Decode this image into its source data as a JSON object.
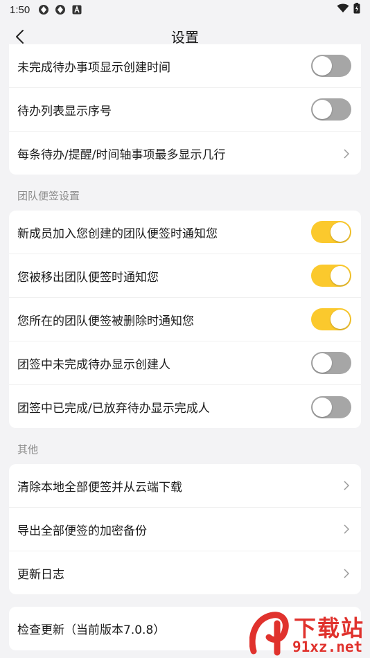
{
  "status_bar": {
    "time": "1:50"
  },
  "header": {
    "title": "设置"
  },
  "card_top": {
    "rows": [
      {
        "label": "未完成待办事项显示创建时间",
        "control": "toggle",
        "on": false
      },
      {
        "label": "待办列表显示序号",
        "control": "toggle",
        "on": false
      },
      {
        "label": "每条待办/提醒/时间轴事项最多显示几行",
        "control": "chevron"
      }
    ]
  },
  "team_section": {
    "title": "团队便签设置",
    "rows": [
      {
        "label": "新成员加入您创建的团队便签时通知您",
        "control": "toggle",
        "on": true
      },
      {
        "label": "您被移出团队便签时通知您",
        "control": "toggle",
        "on": true
      },
      {
        "label": "您所在的团队便签被删除时通知您",
        "control": "toggle",
        "on": true
      },
      {
        "label": "团签中未完成待办显示创建人",
        "control": "toggle",
        "on": false
      },
      {
        "label": "团签中已完成/已放弃待办显示完成人",
        "control": "toggle",
        "on": false
      }
    ]
  },
  "other_section": {
    "title": "其他",
    "rows": [
      {
        "label": "清除本地全部便签并从云端下载",
        "control": "chevron"
      },
      {
        "label": "导出全部便签的加密备份",
        "control": "chevron"
      },
      {
        "label": "更新日志",
        "control": "chevron"
      }
    ]
  },
  "update_card": {
    "label": "检查更新（当前版本7.0.8）"
  },
  "watermark": {
    "text": "下载站",
    "url_text": "91xz.net"
  },
  "colors": {
    "toggle_on": "#fbc92d",
    "toggle_off": "#a6a6a6",
    "background": "#f3f3f5",
    "watermark_red": "#e0322d"
  }
}
